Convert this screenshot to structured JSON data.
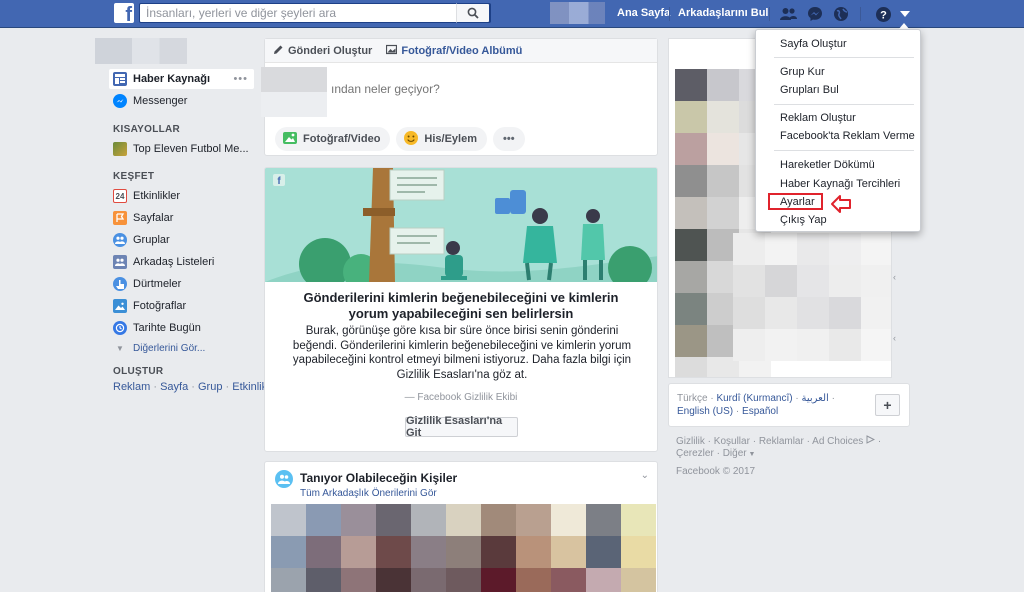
{
  "topbar": {
    "search_placeholder": "İnsanları, yerleri ve diğer şeyleri ara",
    "home": "Ana Sayfa",
    "find_friends": "Arkadaşlarını Bul"
  },
  "left_nav": {
    "news_feed": "Haber Kaynağı",
    "messenger": "Messenger",
    "shortcuts_head": "KISAYOLLAR",
    "shortcut_game": "Top Eleven Futbol Me...",
    "explore_head": "KEŞFET",
    "events": "Etkinlikler",
    "events_date": "24",
    "pages": "Sayfalar",
    "groups": "Gruplar",
    "friend_lists": "Arkadaş Listeleri",
    "pokes": "Dürtmeler",
    "photos": "Fotoğraflar",
    "on_this_day": "Tarihte Bugün",
    "see_more": "Diğerlerini Gör...",
    "create_head": "OLUŞTUR",
    "create_ad": "Reklam",
    "create_page": "Sayfa",
    "create_group": "Grup",
    "create_event": "Etkinlik",
    "link_sep": " · "
  },
  "composer": {
    "tab_post": "Gönderi Oluştur",
    "tab_album": "Fotoğraf/Video Albümü",
    "placeholder": "ından neler geçiyor?",
    "btn_photo": "Fotoğraf/Video",
    "btn_feeling": "His/Eylem",
    "btn_more": "•••"
  },
  "privacy_card": {
    "title": "Gönderilerini kimlerin beğenebileceğini ve kimlerin yorum yapabileceğini sen belirlersin",
    "body": "Burak, görünüşe göre kısa bir süre önce birisi senin gönderini beğendi. Gönderilerini kimlerin beğenebileceğini ve kimlerin yorum yapabileceğini kontrol etmeyi bilmeni istiyoruz. Daha fazla bilgi için Gizlilik Esasları'na göz at.",
    "signature": "— Facebook Gizlilik Ekibi",
    "button": "Gizlilik Esasları'na Git"
  },
  "pymk": {
    "title": "Tanıyor Olabileceğin Kişiler",
    "subtitle": "Tüm Arkadaşlık Önerilerini Gör"
  },
  "languages": {
    "turkce": "Türkçe",
    "kurdi": "Kurdî (Kurmancî)",
    "arabic": "العربية",
    "english": "English (US)",
    "espanol": "Español",
    "plus": "+"
  },
  "footer": {
    "privacy": "Gizlilik",
    "terms": "Koşullar",
    "ads": "Reklamlar",
    "adchoices": "Ad Choices",
    "cookies": "Çerezler",
    "more": "Diğer",
    "copyright": "Facebook © 2017"
  },
  "menu": {
    "create_page": "Sayfa Oluştur",
    "create_group": "Grup Kur",
    "find_groups": "Grupları Bul",
    "create_ad": "Reklam Oluştur",
    "advertise": "Facebook'ta Reklam Verme",
    "activity_log": "Hareketler Dökümü",
    "news_feed_prefs": "Haber Kaynağı Tercihleri",
    "settings": "Ayarlar",
    "logout": "Çıkış Yap"
  },
  "colors": {
    "brand": "#4267b2",
    "link": "#365899",
    "highlight": "#e0232c",
    "illustration_bg": "#a8e0d6"
  }
}
